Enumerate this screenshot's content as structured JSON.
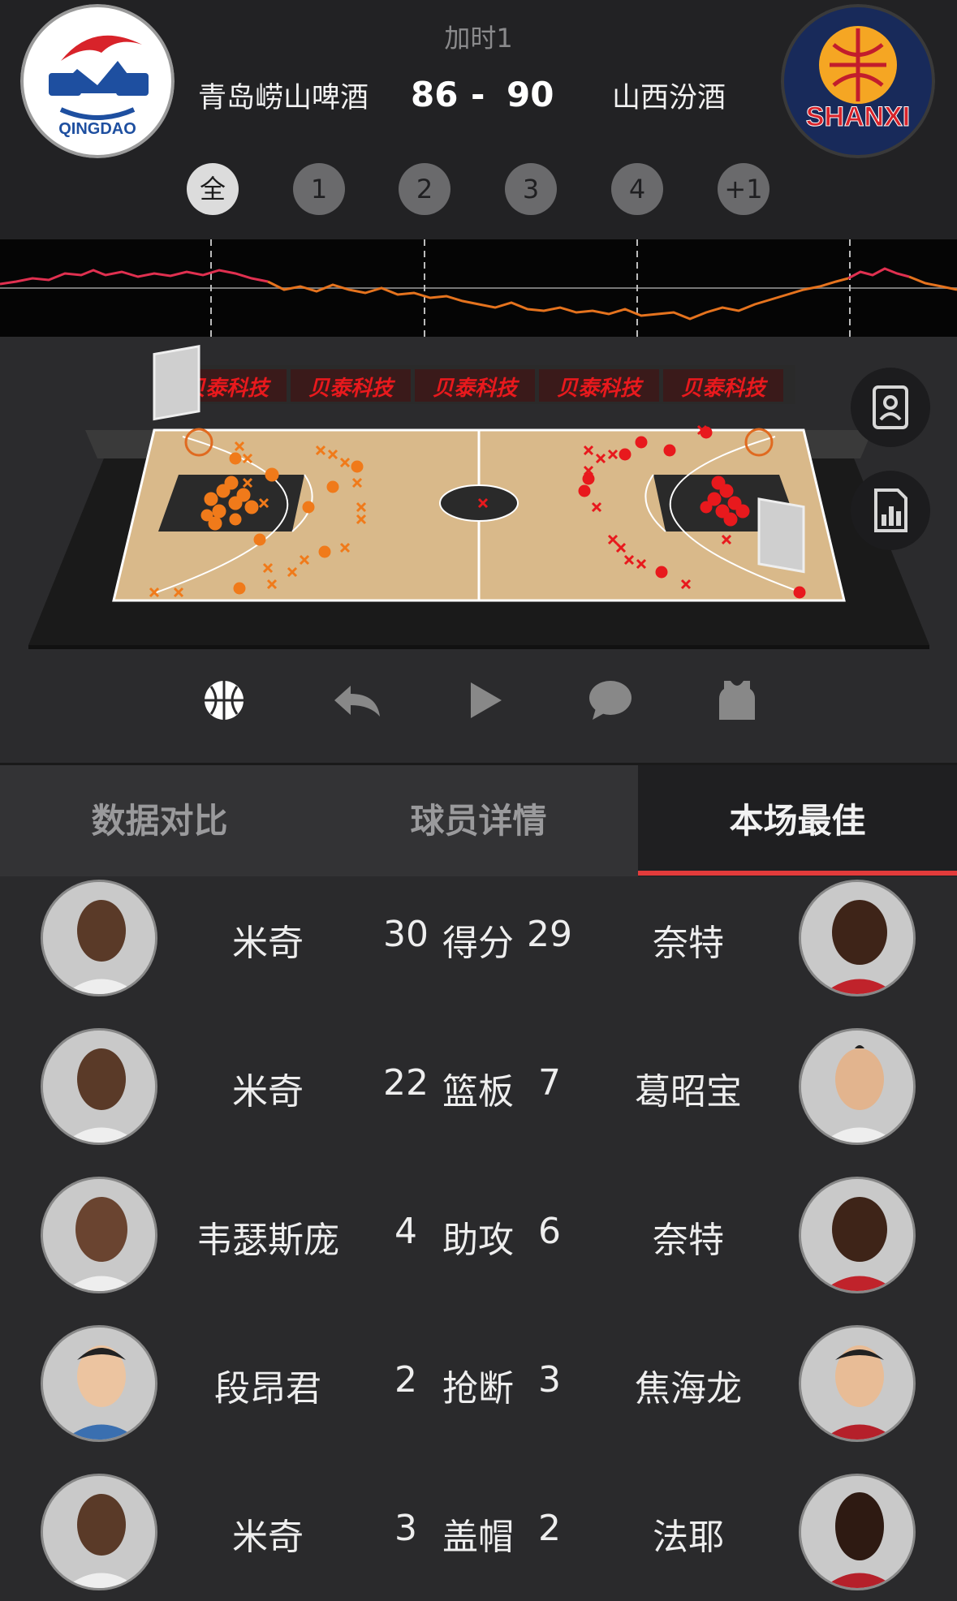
{
  "header": {
    "period": "加时1",
    "home_team": "青岛崂山啤酒",
    "away_team": "山西汾酒",
    "home_score": "86",
    "dash": "-",
    "away_score": "90",
    "home_logo_text": "QINGDAO",
    "away_logo_text": "SHANXI",
    "quarters": [
      "全",
      "1",
      "2",
      "3",
      "4",
      "+1"
    ],
    "active_quarter": "全"
  },
  "court": {
    "sponsor_banner": "贝泰科技",
    "home_color": "#f07a1a",
    "away_color": "#e8191d"
  },
  "controls": [
    "basketball-icon",
    "reply-icon",
    "play-icon",
    "comment-icon",
    "jersey-icon"
  ],
  "side_buttons": [
    "player-card-icon",
    "stats-report-icon"
  ],
  "tabs": [
    {
      "label": "数据对比"
    },
    {
      "label": "球员详情"
    },
    {
      "label": "本场最佳"
    }
  ],
  "best": [
    {
      "left_name": "米奇",
      "left_val": "30",
      "stat": "得分",
      "right_val": "29",
      "right_name": "奈特"
    },
    {
      "left_name": "米奇",
      "left_val": "22",
      "stat": "篮板",
      "right_val": "7",
      "right_name": "葛昭宝"
    },
    {
      "left_name": "韦瑟斯庞",
      "left_val": "4",
      "stat": "助攻",
      "right_val": "6",
      "right_name": "奈特"
    },
    {
      "left_name": "段昂君",
      "left_val": "2",
      "stat": "抢断",
      "right_val": "3",
      "right_name": "焦海龙"
    },
    {
      "left_name": "米奇",
      "left_val": "3",
      "stat": "盖帽",
      "right_val": "2",
      "right_name": "法耶"
    }
  ],
  "colors": {
    "accent": "#e23b3b",
    "home_line": "#e03050",
    "away_line": "#e5731e"
  }
}
